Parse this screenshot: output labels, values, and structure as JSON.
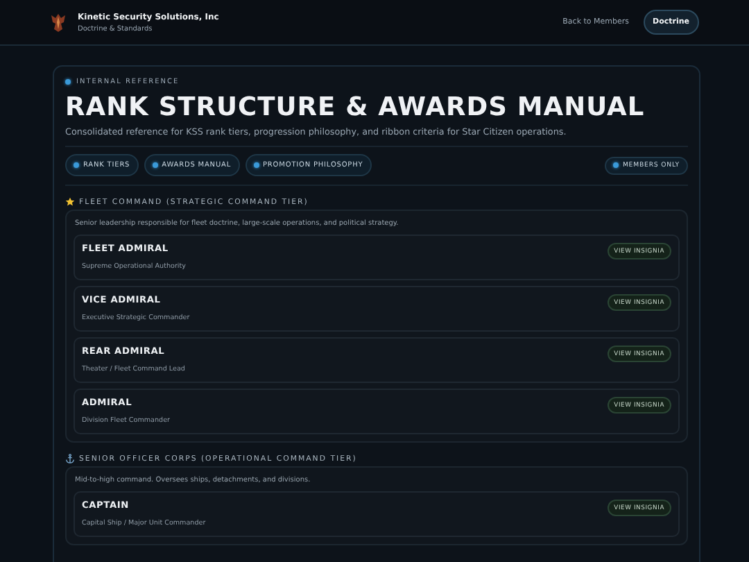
{
  "header": {
    "org_name": "Kinetic Security Solutions, Inc",
    "subtitle": "Doctrine & Standards",
    "nav": [
      {
        "label": "Back to Members",
        "selected": false
      },
      {
        "label": "Doctrine",
        "selected": true
      }
    ]
  },
  "eyebrow": "INTERNAL REFERENCE",
  "title": "RANK STRUCTURE & AWARDS MANUAL",
  "description": "Consolidated reference for KSS rank tiers, progression philosophy, and ribbon criteria for Star Citizen operations.",
  "chips": [
    "RANK TIERS",
    "AWARDS MANUAL",
    "PROMOTION PHILOSOPHY"
  ],
  "access_badge": "MEMBERS ONLY",
  "sections": [
    {
      "heading": "FLEET COMMAND (STRATEGIC COMMAND TIER)",
      "summary": "Senior leadership responsible for fleet doctrine, large-scale operations, and political strategy.",
      "ranks": [
        {
          "name": "FLEET ADMIRAL",
          "role": "Supreme Operational Authority",
          "button": "VIEW INSIGNIA"
        },
        {
          "name": "VICE ADMIRAL",
          "role": "Executive Strategic Commander",
          "button": "VIEW INSIGNIA"
        },
        {
          "name": "REAR ADMIRAL",
          "role": "Theater / Fleet Command Lead",
          "button": "VIEW INSIGNIA"
        },
        {
          "name": "ADMIRAL",
          "role": "Division Fleet Commander",
          "button": "VIEW INSIGNIA"
        }
      ]
    },
    {
      "heading": "SENIOR OFFICER CORPS (OPERATIONAL COMMAND TIER)",
      "summary": "Mid-to-high command. Oversees ships, detachments, and divisions.",
      "ranks": [
        {
          "name": "CAPTAIN",
          "role": "Capital Ship / Major Unit Commander",
          "button": "VIEW INSIGNIA"
        }
      ]
    }
  ]
}
